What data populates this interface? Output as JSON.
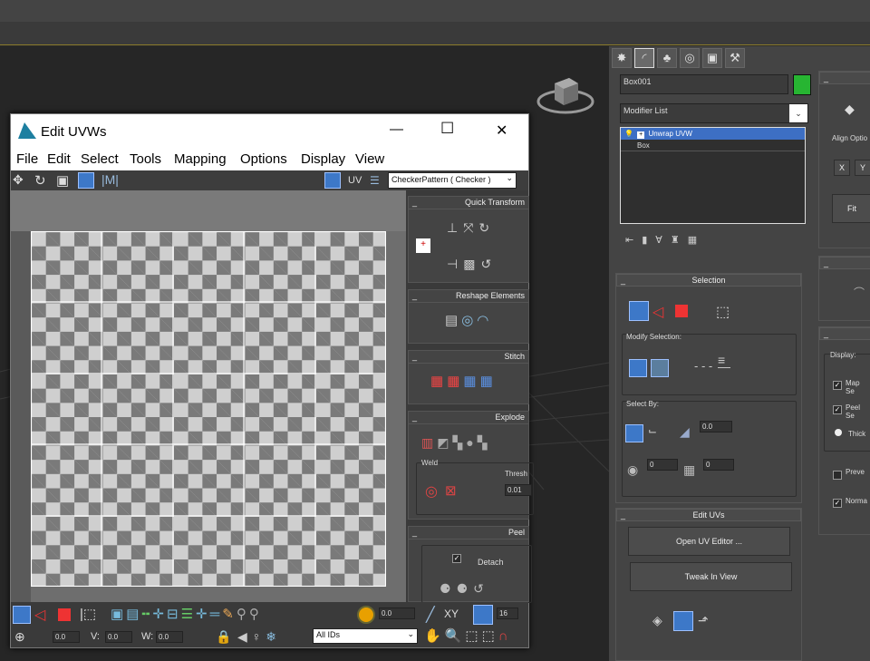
{
  "colors": {
    "accent": "#3d78c8",
    "object_color": "#27b532",
    "checker_dark": "#7a7a7a",
    "checker_light": "#cfcfcf"
  },
  "command_panel": {
    "tab_icons": [
      "create-icon",
      "modify-icon",
      "hierarchy-icon",
      "motion-icon",
      "display-icon",
      "utilities-icon"
    ],
    "object_name": "Box001",
    "modifier_list_label": "Modifier List",
    "stack": [
      {
        "label": "Unwrap UVW",
        "selected": true
      },
      {
        "label": "Box",
        "selected": false
      }
    ],
    "selection": {
      "title": "Selection",
      "modify_selection_label": "Modify Selection:",
      "select_by_label": "Select By:",
      "angle_value": "0.0",
      "spin1_value": "0",
      "spin2_value": "0"
    },
    "edit_uvs": {
      "title": "Edit UVs",
      "open_label": "Open UV Editor ...",
      "tweak_label": "Tweak In View"
    },
    "right_col": {
      "align_label": "Align Optio",
      "x_label": "X",
      "y_label": "Y",
      "fit_label": "Fit",
      "display_label": "Display:",
      "opt1": "Map Se",
      "opt2": "Peel Se",
      "opt3": "Thick",
      "opt4": "Preve",
      "opt5": "Norma"
    }
  },
  "uv_window": {
    "title": "Edit UVWs",
    "controls": {
      "minimize": "—",
      "maximize": "☐",
      "close": "✕"
    },
    "menu": [
      "File",
      "Edit",
      "Select",
      "Tools",
      "Mapping",
      "Options",
      "Display",
      "View"
    ],
    "uv_label": "UV",
    "texture_dropdown": "CheckerPattern  ( Checker )",
    "panels": {
      "quick_transform": "Quick Transform",
      "reshape": "Reshape Elements",
      "stitch": "Stitch",
      "explode": "Explode",
      "weld": "Weld",
      "thresh_label": "Thresh",
      "thresh_value": "0.01",
      "peel": "Peel",
      "detach": "Detach"
    },
    "bottom": {
      "soft_value": "0.0",
      "count_value": "16",
      "xy_label": "XY",
      "u_value": "0.0",
      "v_label": "V:",
      "v_value": "0.0",
      "w_label": "W:",
      "w_value": "0.0",
      "ids_dropdown": "All IDs"
    }
  }
}
